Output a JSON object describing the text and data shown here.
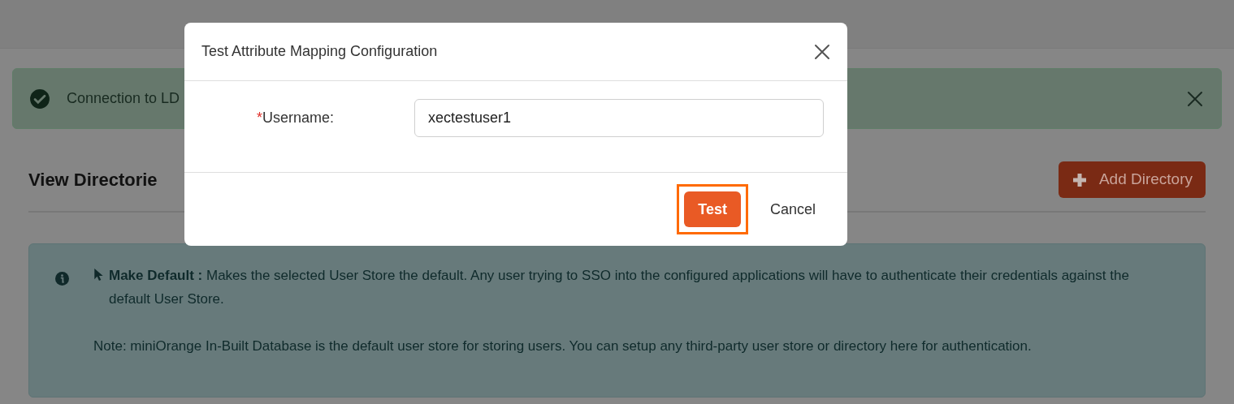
{
  "alert": {
    "text": "Connection to LD"
  },
  "section": {
    "title": "View Directorie",
    "add_button": "Add Directory"
  },
  "info": {
    "paragraphs": [
      "**Make Default :** Makes the selected User Store the default. Any user trying to SSO into the configured applications will have to authenticate their credentials against the default User Store.",
      "Note: miniOrange In-Built Database is the default user store for storing users. You can setup any third-party user store or directory here for authentication."
    ]
  },
  "dialog": {
    "title": "Test Attribute Mapping Configuration",
    "field": {
      "required_mark": "*",
      "label": "Username:",
      "value": "xectestuser1"
    },
    "buttons": [
      {
        "label": "Test",
        "kind": "primary",
        "highlighted": true
      },
      {
        "label": "Cancel",
        "kind": "plain",
        "highlighted": false
      }
    ]
  }
}
